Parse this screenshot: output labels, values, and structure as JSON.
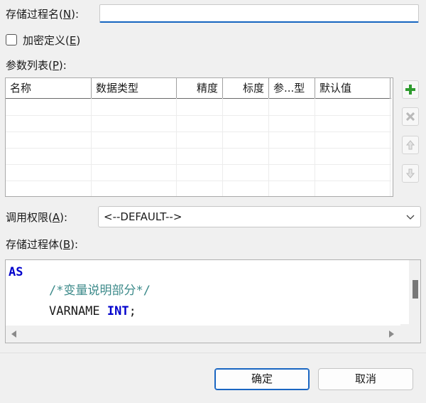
{
  "form": {
    "name_label_pre": "存储过程名(",
    "name_label_key": "N",
    "name_label_post": "):",
    "name_value": "",
    "encrypt_label_pre": "加密定义(",
    "encrypt_label_key": "E",
    "encrypt_label_post": ")",
    "encrypt_checked": false,
    "params_label_pre": "参数列表(",
    "params_label_key": "P",
    "params_label_post": "):",
    "perm_label_pre": "调用权限(",
    "perm_label_key": "A",
    "perm_label_post": "):",
    "perm_value": "<--DEFAULT-->",
    "body_label_pre": "存储过程体(",
    "body_label_key": "B",
    "body_label_post": "):"
  },
  "table": {
    "columns": [
      "名称",
      "数据类型",
      "精度",
      "标度",
      "参...型",
      "默认值"
    ],
    "rows": []
  },
  "side_buttons": [
    "add-icon",
    "delete-icon",
    "move-up-icon",
    "move-down-icon"
  ],
  "editor": {
    "line1": "AS",
    "line2": "/*变量说明部分*/",
    "line3_name": "VARNAME",
    "line3_type": "INT",
    "line3_end": ";"
  },
  "buttons": {
    "ok": "确定",
    "cancel": "取消"
  },
  "colors": {
    "accent": "#1a66c2",
    "add_green": "#2e9b2e",
    "keyword": "#0000cc",
    "comment": "#3c8a8a"
  }
}
